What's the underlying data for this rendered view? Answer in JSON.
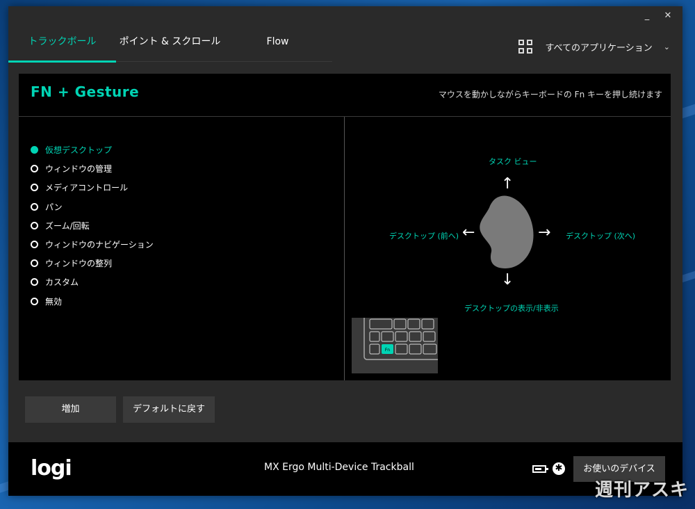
{
  "window": {
    "minimize_label": "_",
    "close_label": "✕"
  },
  "tabs": [
    {
      "label": "トラックボール",
      "active": true
    },
    {
      "label": "ポイント & スクロール",
      "active": false
    },
    {
      "label": "Flow",
      "active": false
    }
  ],
  "app_selector": {
    "icon": "grid-icon",
    "label": "すべてのアプリケーション"
  },
  "panel": {
    "title": "FN + Gesture",
    "hint": "マウスを動かしながらキーボードの Fn キーを押し続けます",
    "options": [
      {
        "label": "仮想デスクトップ",
        "selected": true
      },
      {
        "label": "ウィンドウの管理",
        "selected": false
      },
      {
        "label": "メディアコントロール",
        "selected": false
      },
      {
        "label": "パン",
        "selected": false
      },
      {
        "label": "ズーム/回転",
        "selected": false
      },
      {
        "label": "ウィンドウのナビゲーション",
        "selected": false
      },
      {
        "label": "ウィンドウの整列",
        "selected": false
      },
      {
        "label": "カスタム",
        "selected": false
      },
      {
        "label": "無効",
        "selected": false
      }
    ],
    "gesture": {
      "up": "タスク ビュー",
      "left": "デスクトップ (前へ)",
      "right": "デスクトップ (次へ)",
      "down": "デスクトップの表示/非表示",
      "fn_key": "Fn"
    }
  },
  "buttons": {
    "add": "増加",
    "default": "デフォルトに戻す"
  },
  "footer": {
    "logo": "logi",
    "device_name": "MX Ergo Multi-Device Trackball",
    "devices_button": "お使いのデバイス"
  },
  "watermark": "週刊アスキー",
  "colors": {
    "accent": "#00d4b4",
    "panel_bg": "#000000",
    "window_bg": "#2a2a2a"
  }
}
